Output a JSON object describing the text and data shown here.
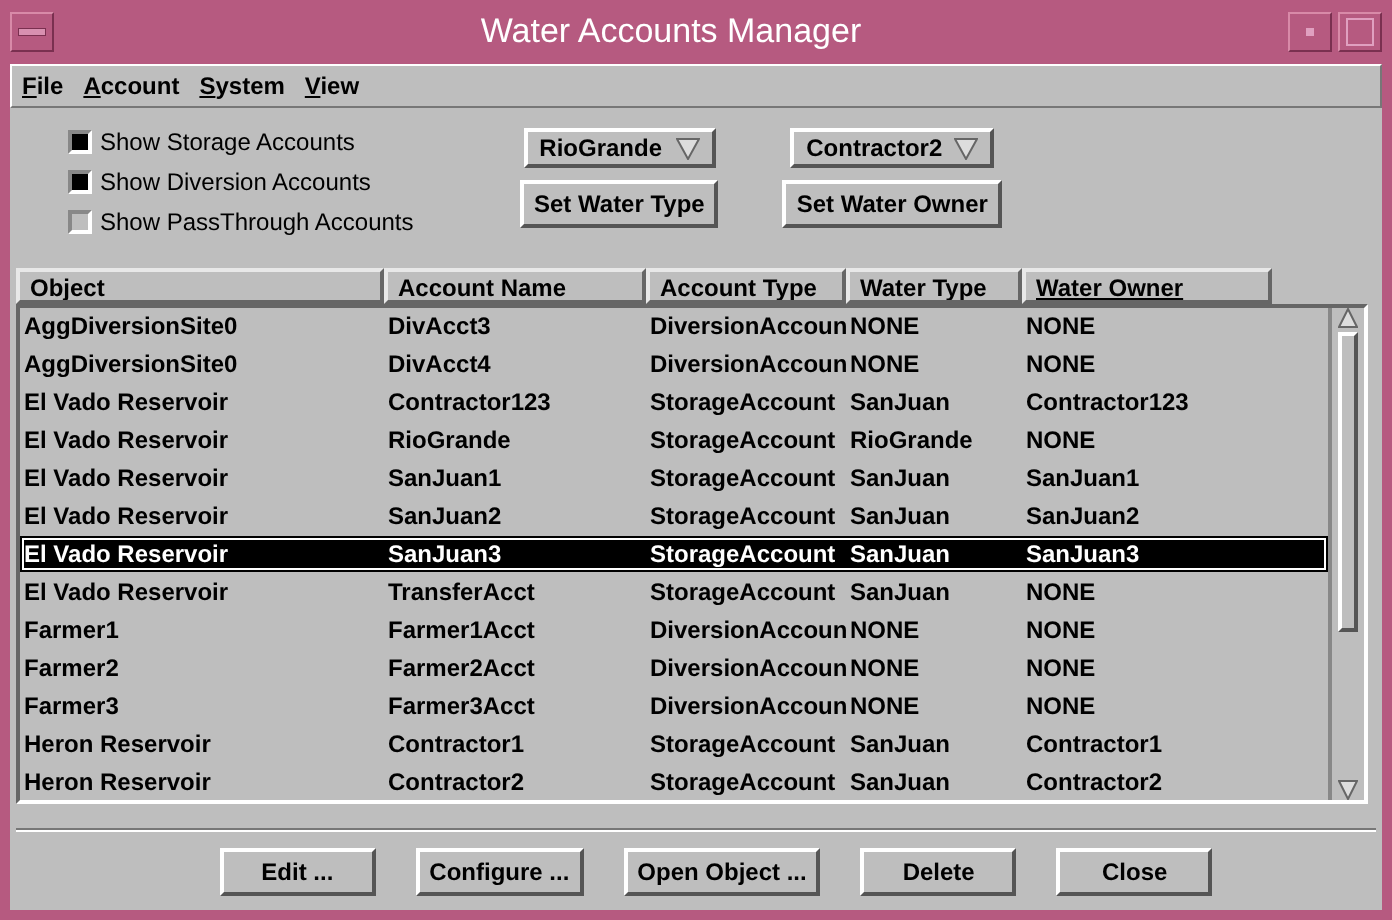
{
  "window": {
    "title": "Water Accounts Manager"
  },
  "menu": [
    "File",
    "Account",
    "System",
    "View"
  ],
  "checkboxes": [
    {
      "label": "Show Storage Accounts",
      "checked": true
    },
    {
      "label": "Show Diversion Accounts",
      "checked": true
    },
    {
      "label": "Show PassThrough Accounts",
      "checked": false
    }
  ],
  "dropdowns": [
    {
      "value": "RioGrande",
      "button": "Set Water Type"
    },
    {
      "value": "Contractor2",
      "button": "Set Water Owner"
    }
  ],
  "table": {
    "columns": [
      {
        "label": "Object",
        "sorted": false
      },
      {
        "label": "Account Name",
        "sorted": false
      },
      {
        "label": "Account Type",
        "sorted": false
      },
      {
        "label": "Water Type",
        "sorted": false
      },
      {
        "label": "Water Owner",
        "sorted": true
      }
    ],
    "rows": [
      {
        "cells": [
          "AggDiversionSite0",
          "DivAcct3",
          "DiversionAccoun",
          "NONE",
          "NONE"
        ],
        "selected": false
      },
      {
        "cells": [
          "AggDiversionSite0",
          "DivAcct4",
          "DiversionAccoun",
          "NONE",
          "NONE"
        ],
        "selected": false
      },
      {
        "cells": [
          "El Vado Reservoir",
          "Contractor123",
          "StorageAccount",
          "SanJuan",
          "Contractor123"
        ],
        "selected": false
      },
      {
        "cells": [
          "El Vado Reservoir",
          "RioGrande",
          "StorageAccount",
          "RioGrande",
          "NONE"
        ],
        "selected": false
      },
      {
        "cells": [
          "El Vado Reservoir",
          "SanJuan1",
          "StorageAccount",
          "SanJuan",
          "SanJuan1"
        ],
        "selected": false
      },
      {
        "cells": [
          "El Vado Reservoir",
          "SanJuan2",
          "StorageAccount",
          "SanJuan",
          "SanJuan2"
        ],
        "selected": false
      },
      {
        "cells": [
          "El Vado Reservoir",
          "SanJuan3",
          "StorageAccount",
          "SanJuan",
          "SanJuan3"
        ],
        "selected": true
      },
      {
        "cells": [
          "El Vado Reservoir",
          "TransferAcct",
          "StorageAccount",
          "SanJuan",
          "NONE"
        ],
        "selected": false
      },
      {
        "cells": [
          "Farmer1",
          "Farmer1Acct",
          "DiversionAccoun",
          "NONE",
          "NONE"
        ],
        "selected": false
      },
      {
        "cells": [
          "Farmer2",
          "Farmer2Acct",
          "DiversionAccoun",
          "NONE",
          "NONE"
        ],
        "selected": false
      },
      {
        "cells": [
          "Farmer3",
          "Farmer3Acct",
          "DiversionAccoun",
          "NONE",
          "NONE"
        ],
        "selected": false
      },
      {
        "cells": [
          "Heron Reservoir",
          "Contractor1",
          "StorageAccount",
          "SanJuan",
          "Contractor1"
        ],
        "selected": false
      },
      {
        "cells": [
          "Heron Reservoir",
          "Contractor2",
          "StorageAccount",
          "SanJuan",
          "Contractor2"
        ],
        "selected": false
      }
    ]
  },
  "buttons": [
    "Edit ...",
    "Configure ...",
    "Open Object ...",
    "Delete",
    "Close"
  ]
}
